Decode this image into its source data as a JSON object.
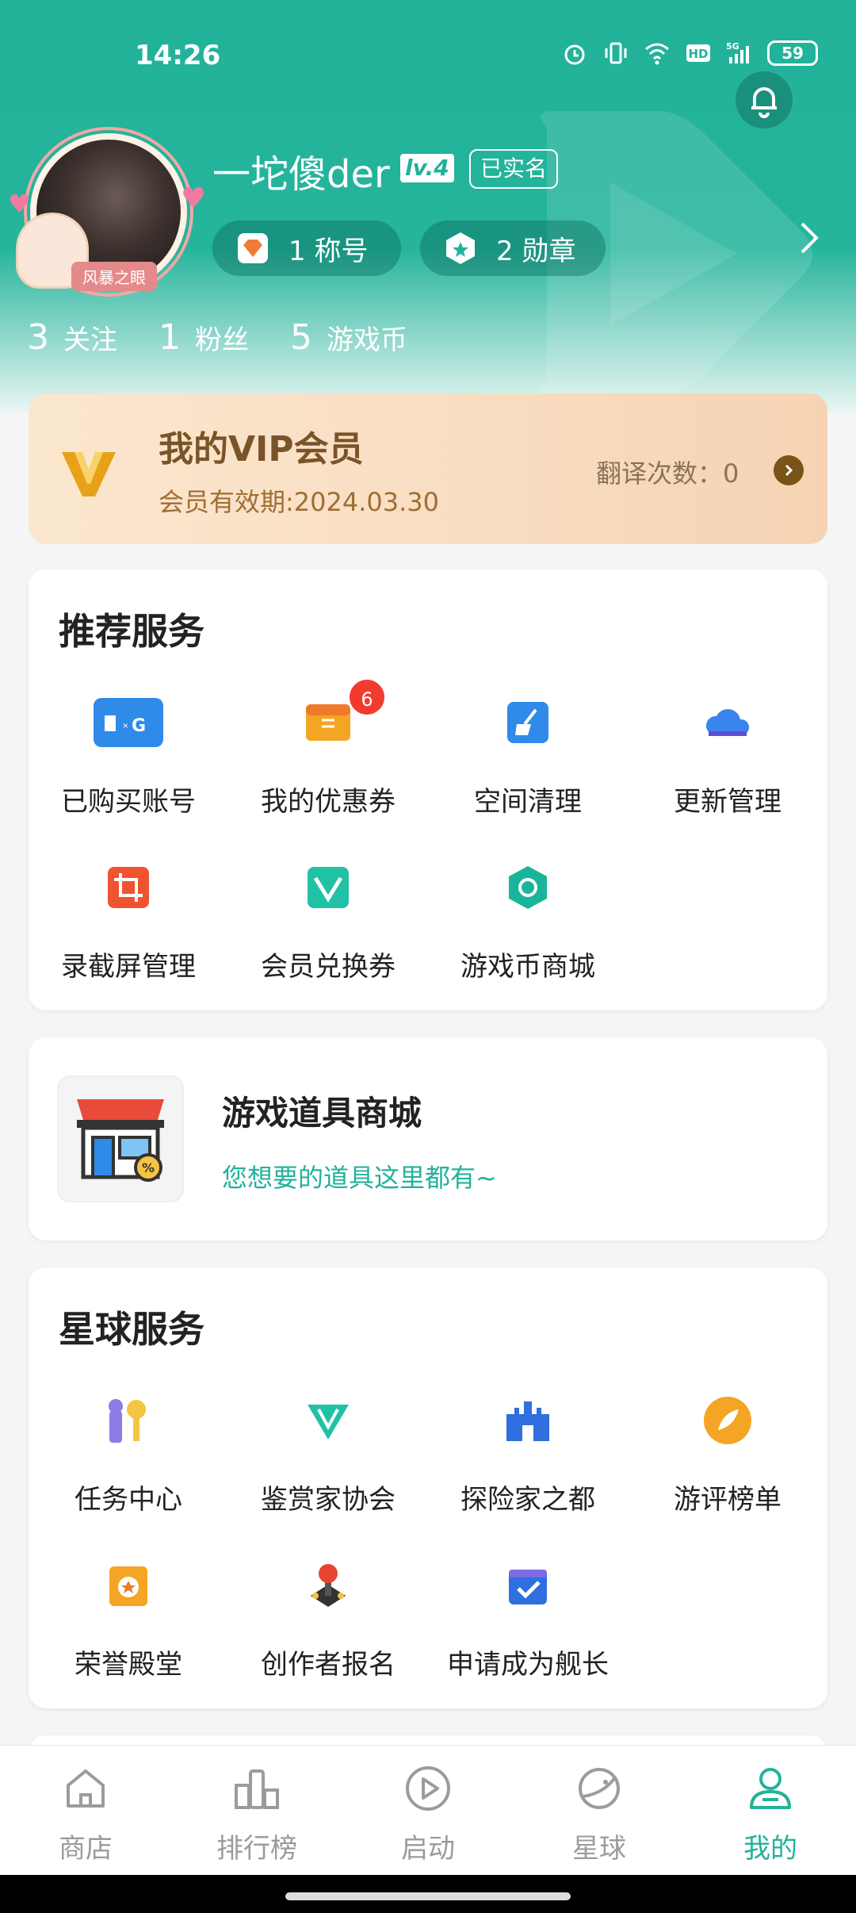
{
  "status_bar": {
    "time": "14:26",
    "battery": "59"
  },
  "profile": {
    "avatar_tag": "风暴之眼",
    "username": "一坨傻der",
    "level": "lv.4",
    "verified": "已实名",
    "titles_label": "1 称号",
    "badges_label": "2 勋章",
    "stats": [
      {
        "num": "3",
        "label": "关注"
      },
      {
        "num": "1",
        "label": "粉丝"
      },
      {
        "num": "5",
        "label": "游戏币"
      }
    ]
  },
  "vip": {
    "title": "我的VIP会员",
    "expiry": "会员有效期:2024.03.30",
    "translate_count": "翻译次数：0"
  },
  "recommended": {
    "title": "推荐服务",
    "items": [
      {
        "label": "已购买账号",
        "icon": "account-icon"
      },
      {
        "label": "我的优惠券",
        "icon": "coupon-icon",
        "badge": "6"
      },
      {
        "label": "空间清理",
        "icon": "cleanup-icon"
      },
      {
        "label": "更新管理",
        "icon": "cloud-icon"
      },
      {
        "label": "录截屏管理",
        "icon": "screen-record-icon"
      },
      {
        "label": "会员兑换券",
        "icon": "vip-voucher-icon"
      },
      {
        "label": "游戏币商城",
        "icon": "coin-mall-icon"
      }
    ]
  },
  "shop": {
    "title": "游戏道具商城",
    "subtitle": "您想要的道具这里都有~"
  },
  "planet": {
    "title": "星球服务",
    "items": [
      {
        "label": "任务中心",
        "icon": "task-center-icon"
      },
      {
        "label": "鉴赏家协会",
        "icon": "connoisseur-icon"
      },
      {
        "label": "探险家之都",
        "icon": "castle-icon"
      },
      {
        "label": "游评榜单",
        "icon": "review-rank-icon"
      },
      {
        "label": "荣誉殿堂",
        "icon": "honor-hall-icon"
      },
      {
        "label": "创作者报名",
        "icon": "creator-icon"
      },
      {
        "label": "申请成为舰长",
        "icon": "captain-icon"
      }
    ]
  },
  "nav": {
    "items": [
      {
        "label": "商店",
        "icon": "store-icon"
      },
      {
        "label": "排行榜",
        "icon": "ranking-icon"
      },
      {
        "label": "启动",
        "icon": "launch-icon"
      },
      {
        "label": "星球",
        "icon": "planet-icon"
      },
      {
        "label": "我的",
        "icon": "profile-icon",
        "active": true
      }
    ]
  },
  "colors": {
    "accent": "#22b29a",
    "vip_text": "#7a5428",
    "badge_red": "#f23a2f"
  }
}
